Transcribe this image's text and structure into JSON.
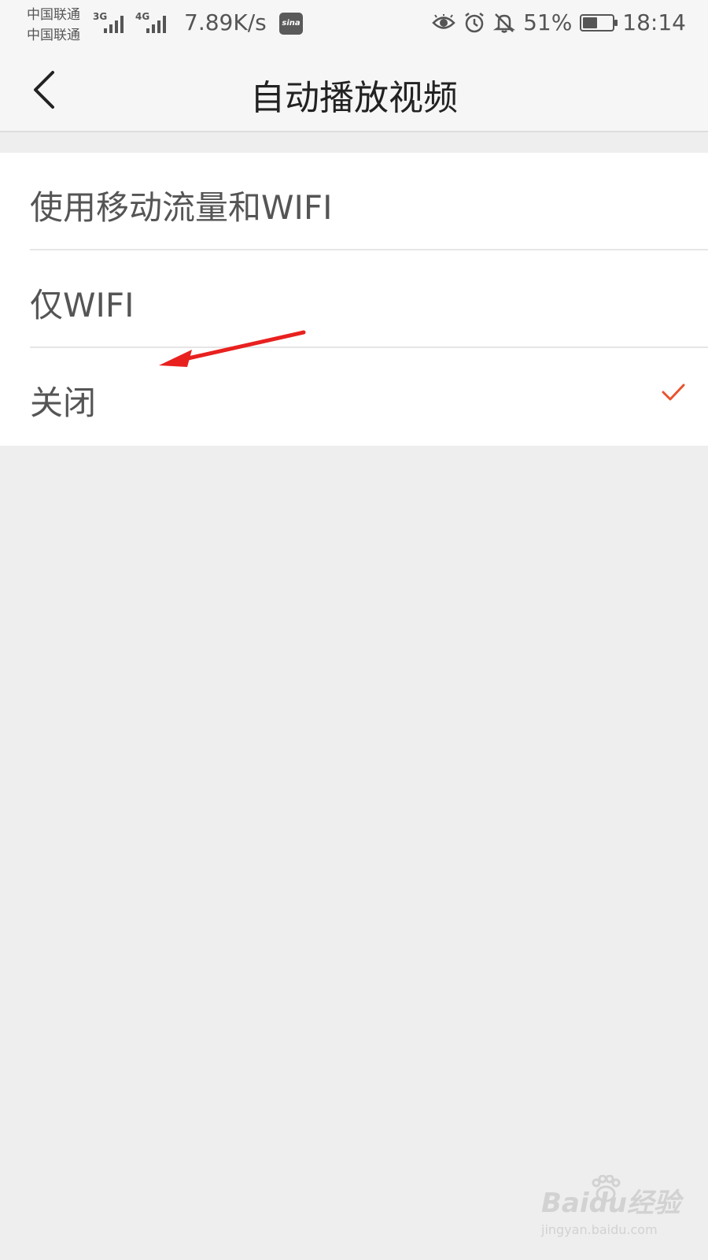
{
  "status_bar": {
    "carrier_1": "中国联通",
    "carrier_2": "中国联通",
    "net_type_1": "3G",
    "net_type_2": "4G",
    "speed": "7.89K/s",
    "sina_icon_text": "sina",
    "battery_percent_text": "51%",
    "battery_level": 0.51,
    "time": "18:14"
  },
  "nav": {
    "title": "自动播放视频"
  },
  "options": [
    {
      "label": "使用移动流量和WIFI",
      "selected": false
    },
    {
      "label": "仅WIFI",
      "selected": false
    },
    {
      "label": "关闭",
      "selected": true
    }
  ],
  "colors": {
    "accent": "#e8542e",
    "annotation": "#e8211f"
  },
  "icons": {
    "back": "chevron-left-icon",
    "check": "check-icon",
    "eye": "eye-icon",
    "alarm": "alarm-icon",
    "mute": "bell-off-icon"
  },
  "watermark": {
    "brand": "Baidu经验",
    "url": "jingyan.baidu.com"
  }
}
